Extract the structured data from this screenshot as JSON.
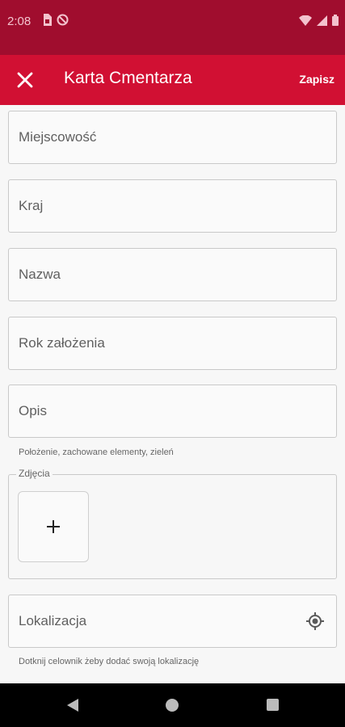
{
  "status_bar": {
    "time": "2:08"
  },
  "app_bar": {
    "title": "Karta Cmentarza",
    "save_label": "Zapisz"
  },
  "form": {
    "fields": [
      {
        "label": "Miejscowość"
      },
      {
        "label": "Kraj"
      },
      {
        "label": "Nazwa"
      },
      {
        "label": "Rok założenia"
      },
      {
        "label": "Opis",
        "helper": "Położenie, zachowane elementy, zieleń"
      }
    ],
    "photos": {
      "legend": "Zdjęcia"
    },
    "location": {
      "label": "Lokalizacja",
      "helper": "Dotknij celownik żeby dodać swoją lokalizację"
    }
  },
  "colors": {
    "status_bar": "#a00d2e",
    "app_bar": "#d11033"
  },
  "icons": [
    "close-icon",
    "add-icon",
    "gps-target-icon",
    "sim-card-icon",
    "notification-icon",
    "wifi-icon",
    "cellular-signal-icon",
    "battery-icon",
    "back-icon",
    "home-icon",
    "recents-icon"
  ]
}
